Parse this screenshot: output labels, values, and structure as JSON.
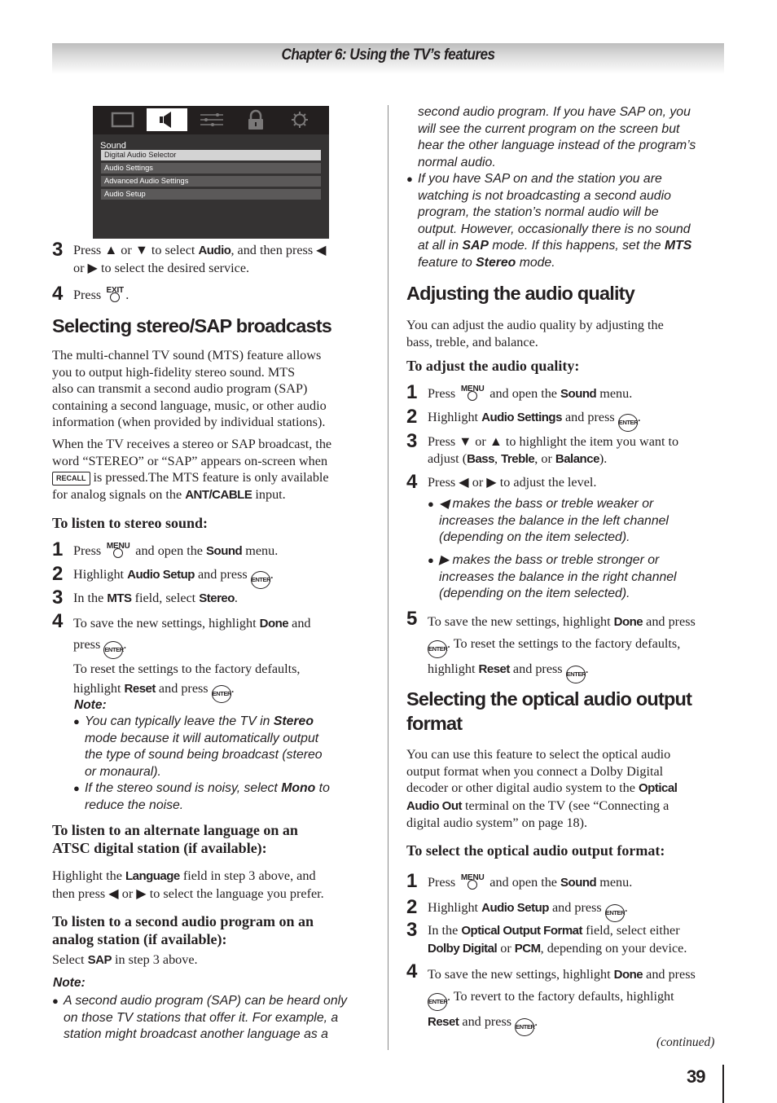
{
  "header": {
    "chapter_title": "Chapter 6: Using the TV’s features"
  },
  "tv_menu": {
    "tabs": [
      {
        "icon": "picture-icon",
        "active": false
      },
      {
        "icon": "speaker-icon",
        "active": true
      },
      {
        "icon": "sliders-icon",
        "active": false
      },
      {
        "icon": "lock-icon",
        "active": false
      },
      {
        "icon": "gear-icon",
        "active": false
      }
    ],
    "title": "Sound",
    "items": [
      {
        "label": "Digital Audio Selector",
        "selected": true
      },
      {
        "label": "Audio Settings",
        "selected": false
      },
      {
        "label": "Advanced Audio Settings",
        "selected": false
      },
      {
        "label": "Audio Setup",
        "selected": false
      }
    ]
  },
  "buttons": {
    "menu": "MENU",
    "exit": "EXIT",
    "enter": "ENTER",
    "recall": "RECALL"
  },
  "left": {
    "step3": {
      "num": "3",
      "t1": "Press ▲ or ▼ to select ",
      "k1": "Audio",
      "t2": ", and then press ◀",
      "t3": "or ▶ to select the desired service."
    },
    "step4": {
      "num": "4",
      "t1": "Press ",
      "t2": "."
    },
    "stereo_heading": "Selecting stereo/SAP broadcasts",
    "para1": [
      "The multi-channel TV sound (MTS) feature allows",
      "you to output high-fidelity stereo sound. MTS",
      "also can transmit a second audio program (SAP)",
      "containing a second language, music, or other audio",
      "information (when provided by individual stations)."
    ],
    "para2": {
      "l1": "When the TV receives a stereo or SAP broadcast, the",
      "l2": "word “STEREO” or “SAP” appears on-screen when",
      "l3": " is pressed.The MTS feature is only available",
      "l4a": "for analog signals on the ",
      "l4k": "ANT/CABLE",
      "l4b": " input."
    },
    "stereo_sub": "To listen to stereo sound:",
    "stereo_steps": {
      "s1": {
        "num": "1",
        "t1": "Press ",
        "t2": " and open the ",
        "k": "Sound",
        "t3": " menu."
      },
      "s2": {
        "num": "2",
        "t1": "Highlight ",
        "k": "Audio Setup",
        "t2": " and press ",
        "t3": "."
      },
      "s3": {
        "num": "3",
        "t1": "In the ",
        "k1": "MTS",
        "t2": " field, select ",
        "k2": "Stereo",
        "t3": "."
      },
      "s4": {
        "num": "4",
        "t1": "To save the new settings, highlight ",
        "k": "Done",
        "t2": " and",
        "t3": "press ",
        "t4": ".",
        "t5": "To reset the settings to the factory defaults,",
        "t6": "highlight ",
        "k2": "Reset",
        "t7": " and press ",
        "t8": "."
      }
    },
    "note_label": "Note:",
    "note1": {
      "a": "You can typically leave the TV in ",
      "k": "Stereo",
      "l2": "mode because it will automatically output",
      "l3": "the type of sound being broadcast (stereo",
      "l4": "or monaural)."
    },
    "note2": {
      "a": "If the stereo sound is noisy, select ",
      "k": "Mono",
      "b": " to",
      "l2": "reduce the noise."
    },
    "atsc_sub": [
      "To listen to an alternate language on an",
      "ATSC digital station (if available):"
    ],
    "atsc_para": {
      "t1": "Highlight the ",
      "k": "Language",
      "t2": " field in step 3 above, and",
      "l2": "then press ◀ or ▶ to select the language you prefer."
    },
    "sap_sub": [
      "To listen to a second audio program on an",
      "analog station (if available):"
    ],
    "sap_para": {
      "t1": "Select ",
      "k": "SAP",
      "t2": " in step 3 above."
    },
    "note2_label": "Note:",
    "sap_note": [
      "A second audio program (SAP) can be heard only",
      "on those TV stations that offer it. For example, a",
      "station might broadcast another language as a"
    ]
  },
  "right": {
    "sap_note_cont": [
      "second audio program. If you have SAP on, you",
      "will see the current program on the screen but",
      "hear the other language instead of the program’s",
      "normal audio."
    ],
    "note_b": {
      "l1": "If you have SAP on and the station you are",
      "l2": "watching is not broadcasting a second audio",
      "l3": "program, the station’s normal audio will be",
      "l4": "output. However, occasionally there is no sound",
      "l5a": "at all in ",
      "l5k1": "SAP",
      "l5b": " mode. If this happens, set the ",
      "l5k2": "MTS",
      "l6a": "feature to ",
      "l6k": "Stereo",
      "l6b": " mode."
    },
    "quality_heading": "Adjusting the audio quality",
    "quality_para": [
      "You can adjust the audio quality by adjusting the",
      "bass, treble, and balance."
    ],
    "quality_sub": "To adjust the audio quality:",
    "q_steps": {
      "s1": {
        "num": "1",
        "t1": "Press ",
        "t2": " and open the ",
        "k": "Sound",
        "t3": " menu."
      },
      "s2": {
        "num": "2",
        "t1": "Highlight ",
        "k": "Audio Settings",
        "t2": " and press ",
        "t3": "."
      },
      "s3": {
        "num": "3",
        "t1": "Press ▼ or ▲ to highlight the item you want to",
        "t2": "adjust (",
        "k1": "Bass",
        "c1": ", ",
        "k2": "Treble",
        "c2": ", or ",
        "k3": "Balance",
        "t3": ")."
      },
      "s4": {
        "num": "4",
        "t1": "Press ◀ or ▶ to adjust the level."
      },
      "b1": [
        "◀ makes the bass or treble weaker or",
        "increases the balance in the left channel",
        "(depending on the item selected)."
      ],
      "b2": [
        "▶ makes the bass or treble stronger or",
        "increases the balance in the right channel",
        "(depending on the item selected)."
      ],
      "s5": {
        "num": "5",
        "t1": "To save the new settings, highlight ",
        "k": "Done",
        "t2": " and press",
        "t3": ". To reset the settings to the factory defaults,",
        "t4": "highlight ",
        "k2": "Reset",
        "t5": " and press ",
        "t6": "."
      }
    },
    "optical_heading": [
      "Selecting the optical audio output",
      "format"
    ],
    "optical_para": {
      "l1": "You can use this feature to select the optical audio",
      "l2": "output format when you connect a Dolby Digital",
      "l3a": "decoder or other digital audio system to the ",
      "l3k": "Optical",
      "l4k": "Audio Out",
      "l4b": " terminal on the TV (see “Connecting a",
      "l5": "digital audio system” on page 18)."
    },
    "optical_sub": "To select the optical audio output format:",
    "o_steps": {
      "s1": {
        "num": "1",
        "t1": "Press ",
        "t2": " and open the ",
        "k": "Sound",
        "t3": " menu."
      },
      "s2": {
        "num": "2",
        "t1": "Highlight ",
        "k": "Audio Setup",
        "t2": " and press ",
        "t3": "."
      },
      "s3": {
        "num": "3",
        "t1": "In the ",
        "k1": "Optical Output Format",
        "t2": " field, select either",
        "k2": "Dolby Digital",
        "t3": " or ",
        "k3": "PCM",
        "t4": ", depending on your device."
      },
      "s4": {
        "num": "4",
        "t1": "To save the new settings, highlight ",
        "k": "Done",
        "t2": " and press",
        "t3": ". To revert to the factory defaults, highlight",
        "k2": "Reset",
        "t4": " and press ",
        "t5": "."
      }
    },
    "continued": "(continued)"
  },
  "footer": {
    "page_number": "39"
  }
}
